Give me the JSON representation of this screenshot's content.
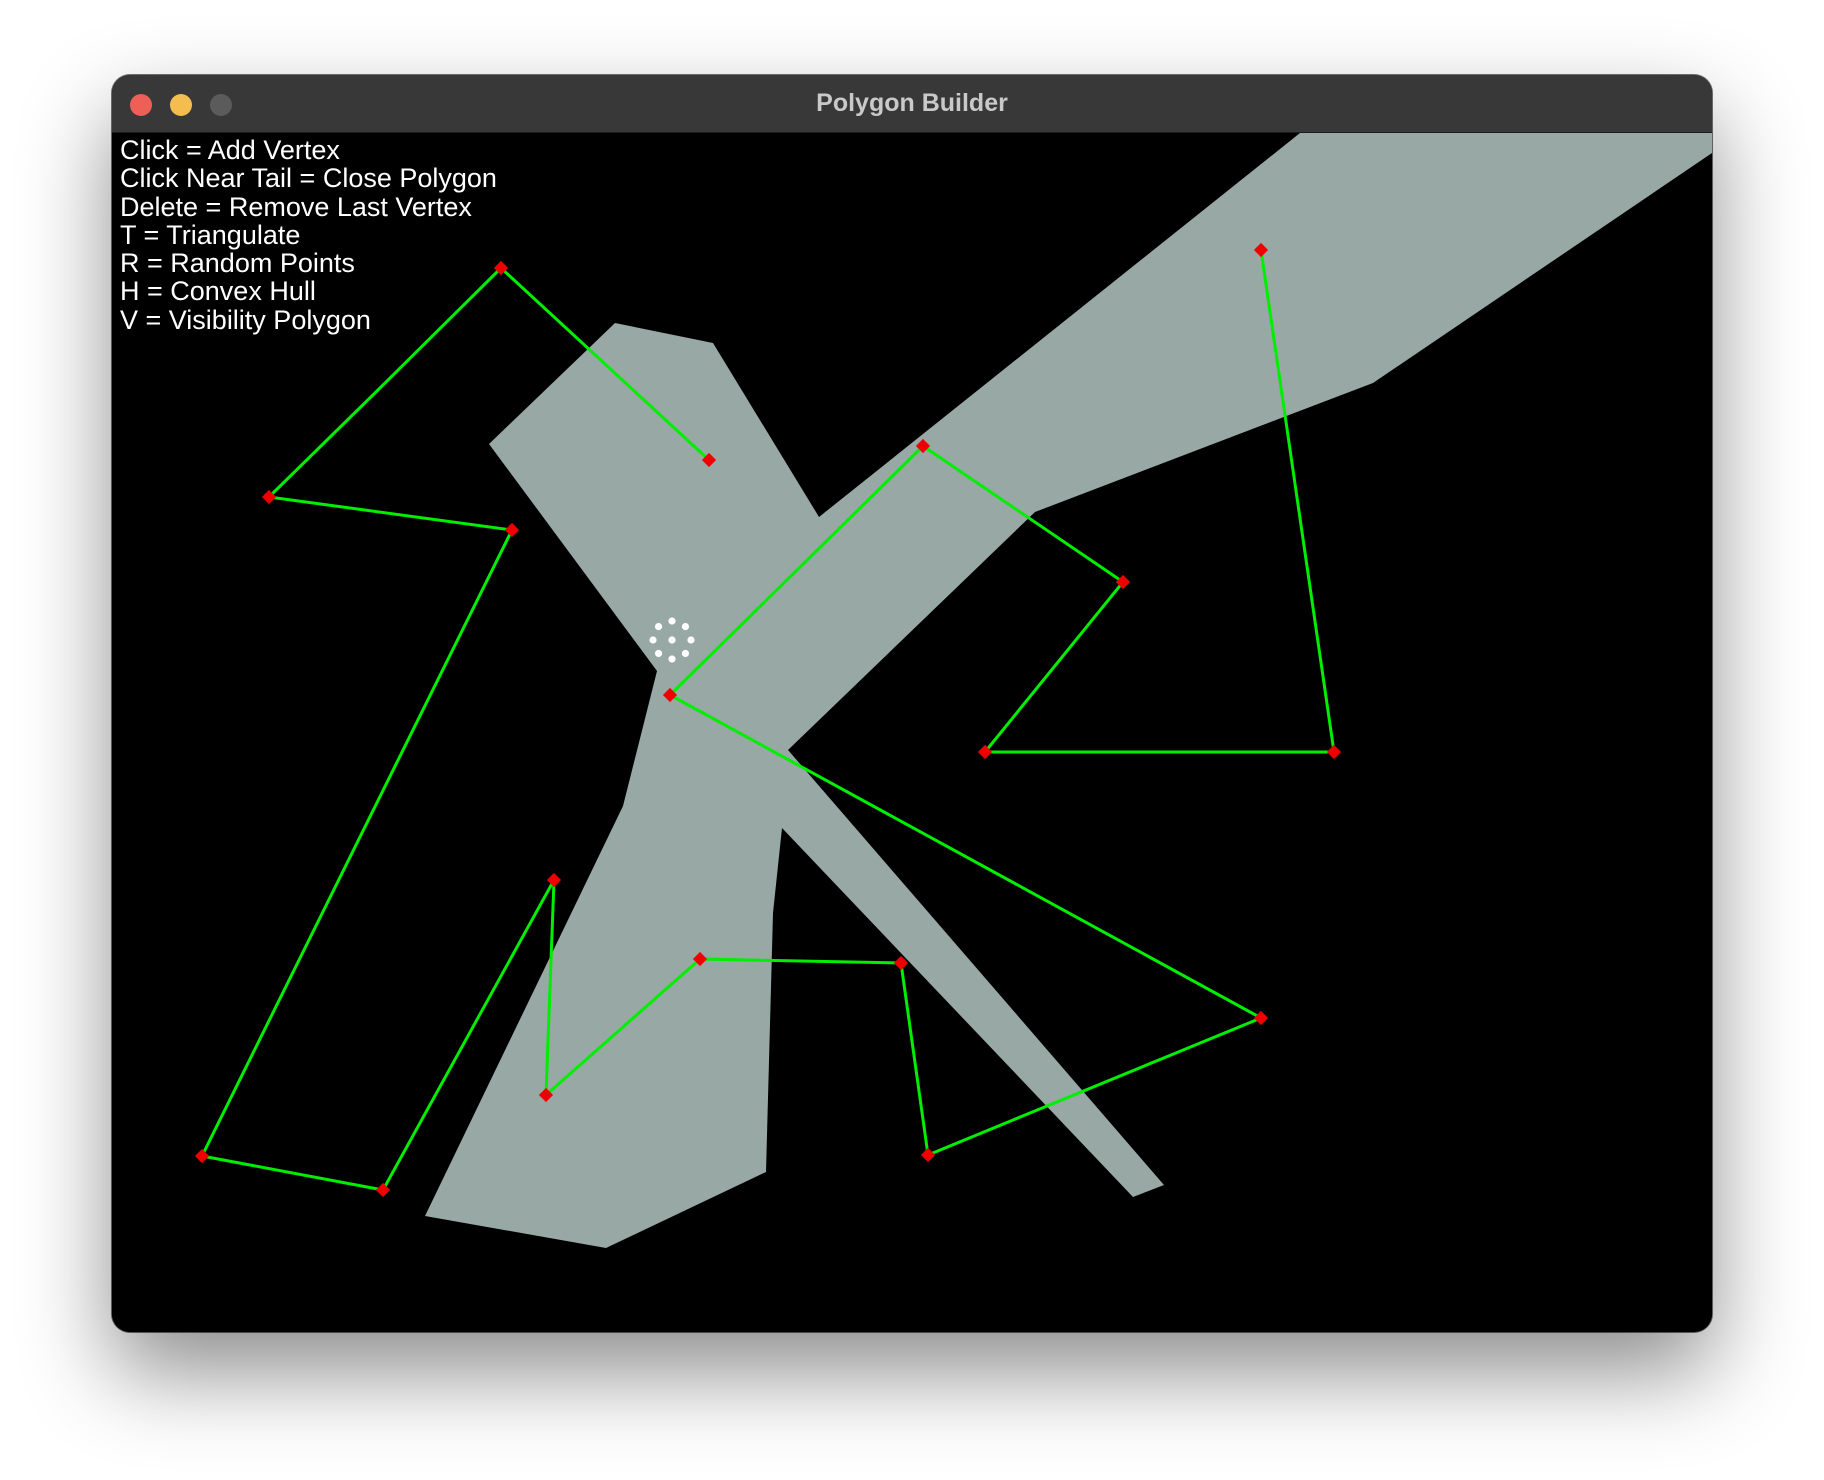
{
  "window": {
    "title": "Polygon Builder"
  },
  "help": [
    "Click = Add Vertex",
    "Click Near Tail = Close Polygon",
    "Delete = Remove Last Vertex",
    "T = Triangulate",
    "R = Random Points",
    "H = Convex Hull",
    "V = Visibility Polygon"
  ],
  "colors": {
    "background": "#000000",
    "visibility_fill": "#98a8a5",
    "edge": "#00ee00",
    "vertex": "#ee0000",
    "query_point": "#ffffff"
  }
}
